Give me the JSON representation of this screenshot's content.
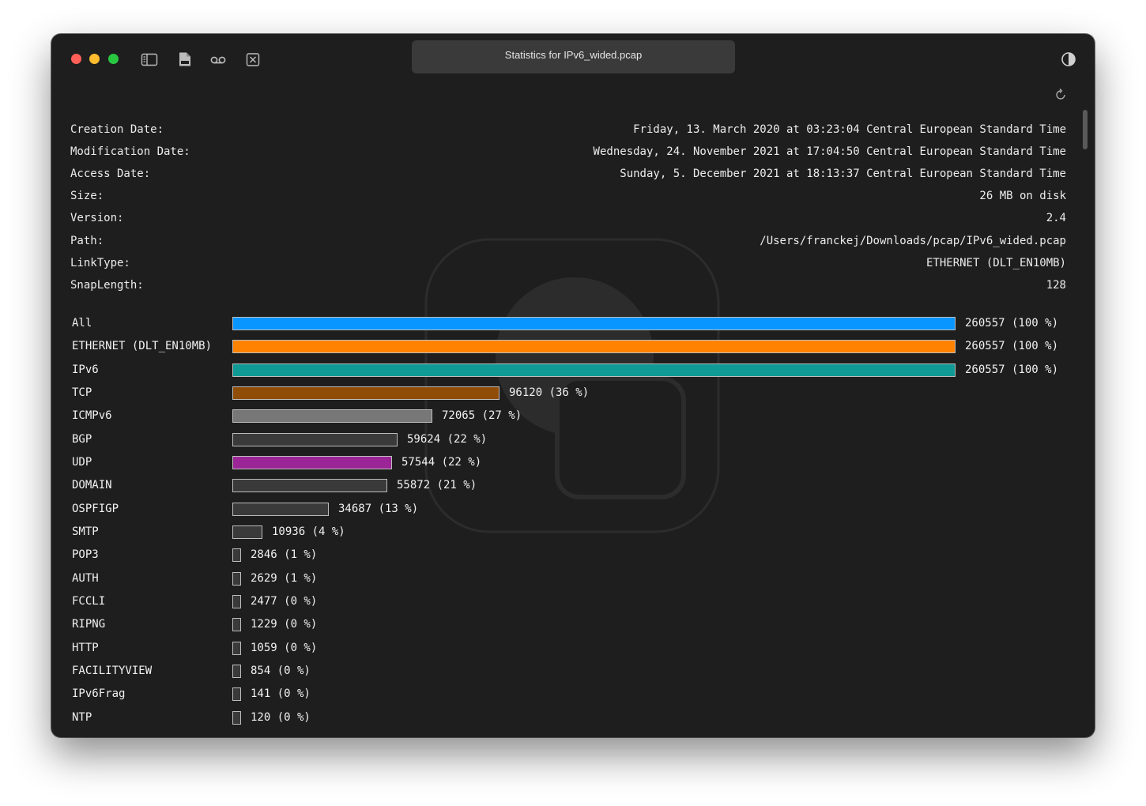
{
  "window": {
    "title": "Statistics for IPv6_wided.pcap"
  },
  "toolbar": {
    "icons": [
      "sidebar-icon",
      "pcap-file-icon",
      "voicemail-icon",
      "close-box-icon"
    ],
    "right_icon": "contrast-icon",
    "refresh_icon": "refresh-icon"
  },
  "info": [
    {
      "label": "Creation Date:",
      "value": "Friday, 13. March 2020 at 03:23:04 Central European Standard Time"
    },
    {
      "label": "Modification Date:",
      "value": "Wednesday, 24. November 2021 at 17:04:50 Central European Standard Time"
    },
    {
      "label": "Access Date:",
      "value": "Sunday, 5. December 2021 at 18:13:37 Central European Standard Time"
    },
    {
      "label": "Size:",
      "value": "26 MB on disk"
    },
    {
      "label": "Version:",
      "value": "2.4"
    },
    {
      "label": "Path:",
      "value": "/Users/franckej/Downloads/pcap/IPv6_wided.pcap"
    },
    {
      "label": "LinkType:",
      "value": "ETHERNET (DLT_EN10MB)"
    },
    {
      "label": "SnapLength:",
      "value": "128"
    }
  ],
  "protocols": [
    {
      "name": "All",
      "count": 260557,
      "label": "260557 (100 %)",
      "color": "#0a96ff"
    },
    {
      "name": "ETHERNET (DLT_EN10MB)",
      "count": 260557,
      "label": "260557 (100 %)",
      "color": "#ff8200"
    },
    {
      "name": "IPv6",
      "count": 260557,
      "label": "260557 (100 %)",
      "color": "#0f9a96"
    },
    {
      "name": "TCP",
      "count": 96120,
      "label": "96120 (36 %)",
      "color": "#8f4d07"
    },
    {
      "name": "ICMPv6",
      "count": 72065,
      "label": "72065 (27 %)",
      "color": "#777777"
    },
    {
      "name": "BGP",
      "count": 59624,
      "label": "59624 (22 %)",
      "color": "#3a3a3a"
    },
    {
      "name": "UDP",
      "count": 57544,
      "label": "57544 (22 %)",
      "color": "#9b2596"
    },
    {
      "name": "DOMAIN",
      "count": 55872,
      "label": "55872 (21 %)",
      "color": "#3a3a3a"
    },
    {
      "name": "OSPFIGP",
      "count": 34687,
      "label": "34687 (13 %)",
      "color": "#3a3a3a"
    },
    {
      "name": "SMTP",
      "count": 10936,
      "label": "10936 (4 %)",
      "color": "#3a3a3a"
    },
    {
      "name": "POP3",
      "count": 2846,
      "label": "2846 (1 %)",
      "color": "#3a3a3a"
    },
    {
      "name": "AUTH",
      "count": 2629,
      "label": "2629 (1 %)",
      "color": "#3a3a3a"
    },
    {
      "name": "FCCLI",
      "count": 2477,
      "label": "2477 (0 %)",
      "color": "#3a3a3a"
    },
    {
      "name": "RIPNG",
      "count": 1229,
      "label": "1229 (0 %)",
      "color": "#3a3a3a"
    },
    {
      "name": "HTTP",
      "count": 1059,
      "label": "1059 (0 %)",
      "color": "#3a3a3a"
    },
    {
      "name": "FACILITYVIEW",
      "count": 854,
      "label": "854 (0 %)",
      "color": "#3a3a3a"
    },
    {
      "name": "IPv6Frag",
      "count": 141,
      "label": "141 (0 %)",
      "color": "#3a3a3a"
    },
    {
      "name": "NTP",
      "count": 120,
      "label": "120 (0 %)",
      "color": "#3a3a3a"
    }
  ]
}
